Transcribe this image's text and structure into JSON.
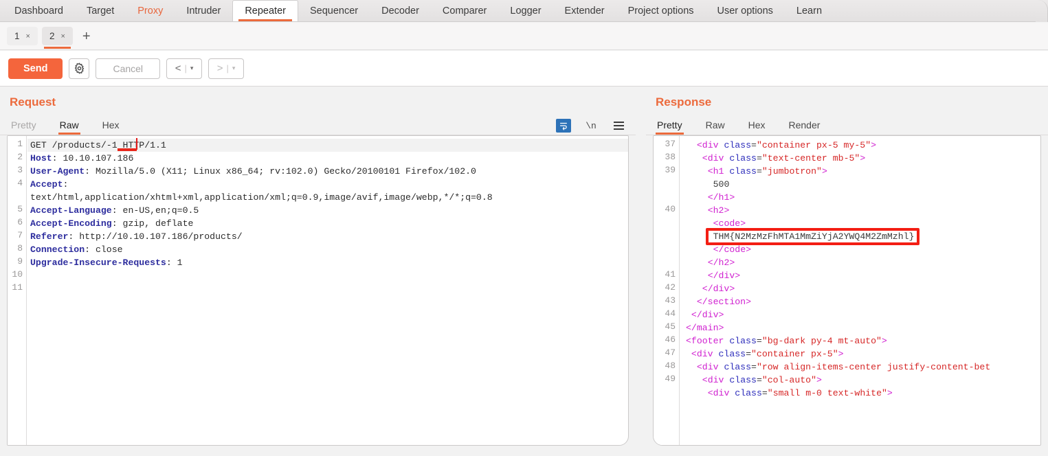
{
  "app": {
    "main_tabs": [
      {
        "label": "Dashboard",
        "state": "normal"
      },
      {
        "label": "Target",
        "state": "normal"
      },
      {
        "label": "Proxy",
        "state": "highlight"
      },
      {
        "label": "Intruder",
        "state": "normal"
      },
      {
        "label": "Repeater",
        "state": "active"
      },
      {
        "label": "Sequencer",
        "state": "normal"
      },
      {
        "label": "Decoder",
        "state": "normal"
      },
      {
        "label": "Comparer",
        "state": "normal"
      },
      {
        "label": "Logger",
        "state": "normal"
      },
      {
        "label": "Extender",
        "state": "normal"
      },
      {
        "label": "Project options",
        "state": "normal"
      },
      {
        "label": "User options",
        "state": "normal"
      },
      {
        "label": "Learn",
        "state": "normal"
      }
    ],
    "accent_color": "#ec6a3c",
    "highlight_color": "#e8663d"
  },
  "repeater_tabs": {
    "tabs": [
      {
        "number": "1",
        "close": "×",
        "active": false
      },
      {
        "number": "2",
        "close": "×",
        "active": true
      }
    ],
    "add_label": "+"
  },
  "toolbar": {
    "send_label": "Send",
    "gear_icon": "gear-icon",
    "cancel_label": "Cancel",
    "back_arrow": "<",
    "forward_arrow": ">",
    "separator": "|",
    "caret": "▾"
  },
  "request": {
    "title": "Request",
    "subtabs": [
      {
        "label": "Pretty",
        "active": false,
        "dim": true
      },
      {
        "label": "Raw",
        "active": true,
        "dim": false
      },
      {
        "label": "Hex",
        "active": false,
        "dim": false
      }
    ],
    "icons": [
      {
        "name": "word-wrap-icon",
        "selected": true
      },
      {
        "name": "newline-icon",
        "label": "\\n",
        "selected": false
      },
      {
        "name": "menu-icon",
        "selected": false
      }
    ],
    "lines": [
      {
        "n": "1",
        "highlight": true,
        "segments": [
          {
            "t": "GET /products/-1 HTTP/1.1",
            "c": "plain"
          }
        ]
      },
      {
        "n": "2",
        "segments": [
          {
            "t": "Host",
            "c": "hdr"
          },
          {
            "t": ": 10.10.107.186",
            "c": "val"
          }
        ]
      },
      {
        "n": "3",
        "segments": [
          {
            "t": "User-Agent",
            "c": "hdr"
          },
          {
            "t": ": Mozilla/5.0 (X11; Linux x86_64; rv:102.0) Gecko/20100101 Firefox/102.0",
            "c": "val"
          }
        ]
      },
      {
        "n": "4",
        "segments": [
          {
            "t": "Accept",
            "c": "hdr"
          },
          {
            "t": ":",
            "c": "val"
          }
        ]
      },
      {
        "n": "",
        "segments": [
          {
            "t": "text/html,application/xhtml+xml,application/xml;q=0.9,image/avif,image/webp,*/*;q=0.8",
            "c": "val"
          }
        ]
      },
      {
        "n": "5",
        "segments": [
          {
            "t": "Accept-Language",
            "c": "hdr"
          },
          {
            "t": ": en-US,en;q=0.5",
            "c": "val"
          }
        ]
      },
      {
        "n": "6",
        "segments": [
          {
            "t": "Accept-Encoding",
            "c": "hdr"
          },
          {
            "t": ": gzip, deflate",
            "c": "val"
          }
        ]
      },
      {
        "n": "7",
        "segments": [
          {
            "t": "Referer",
            "c": "hdr"
          },
          {
            "t": ": http://10.10.107.186/products/",
            "c": "val"
          }
        ]
      },
      {
        "n": "8",
        "segments": [
          {
            "t": "Connection",
            "c": "hdr"
          },
          {
            "t": ": close",
            "c": "val"
          }
        ]
      },
      {
        "n": "9",
        "segments": [
          {
            "t": "Upgrade-Insecure-Requests",
            "c": "hdr"
          },
          {
            "t": ": 1",
            "c": "val"
          }
        ]
      },
      {
        "n": "10",
        "segments": []
      },
      {
        "n": "11",
        "segments": []
      }
    ],
    "annotation": {
      "underline_text": "-1",
      "caret_visible": true
    }
  },
  "response": {
    "title": "Response",
    "subtabs": [
      {
        "label": "Pretty",
        "active": true,
        "dim": false
      },
      {
        "label": "Raw",
        "active": false,
        "dim": false
      },
      {
        "label": "Hex",
        "active": false,
        "dim": false
      },
      {
        "label": "Render",
        "active": false,
        "dim": false
      }
    ],
    "lines": [
      {
        "n": "37",
        "indent": 2,
        "segments": [
          {
            "t": "<",
            "c": "tag"
          },
          {
            "t": "div",
            "c": "tag"
          },
          {
            "t": " class",
            "c": "attr"
          },
          {
            "t": "=",
            "c": "txt"
          },
          {
            "t": "\"container px-5 my-5\"",
            "c": "str"
          },
          {
            "t": ">",
            "c": "tag"
          }
        ]
      },
      {
        "n": "38",
        "indent": 3,
        "segments": [
          {
            "t": "<",
            "c": "tag"
          },
          {
            "t": "div",
            "c": "tag"
          },
          {
            "t": " class",
            "c": "attr"
          },
          {
            "t": "=",
            "c": "txt"
          },
          {
            "t": "\"text-center mb-5\"",
            "c": "str"
          },
          {
            "t": ">",
            "c": "tag"
          }
        ]
      },
      {
        "n": "39",
        "indent": 4,
        "segments": [
          {
            "t": "<",
            "c": "tag"
          },
          {
            "t": "h1",
            "c": "tag"
          },
          {
            "t": " class",
            "c": "attr"
          },
          {
            "t": "=",
            "c": "txt"
          },
          {
            "t": "\"jumbotron\"",
            "c": "str"
          },
          {
            "t": ">",
            "c": "tag"
          }
        ]
      },
      {
        "n": "",
        "indent": 5,
        "segments": [
          {
            "t": "500",
            "c": "txt"
          }
        ]
      },
      {
        "n": "",
        "indent": 4,
        "segments": [
          {
            "t": "</h1>",
            "c": "tag"
          }
        ]
      },
      {
        "n": "40",
        "indent": 4,
        "segments": [
          {
            "t": "<h2>",
            "c": "tag"
          }
        ]
      },
      {
        "n": "",
        "indent": 5,
        "segments": [
          {
            "t": "<code>",
            "c": "tag"
          }
        ]
      },
      {
        "n": "",
        "indent": 5,
        "flag": true,
        "segments": [
          {
            "t": "THM{N2MzMzFhMTA1MmZiYjA2YWQ4M2ZmMzhl}",
            "c": "txt"
          }
        ]
      },
      {
        "n": "",
        "indent": 5,
        "segments": [
          {
            "t": "</code>",
            "c": "tag"
          }
        ]
      },
      {
        "n": "",
        "indent": 4,
        "segments": [
          {
            "t": "</h2>",
            "c": "tag"
          }
        ]
      },
      {
        "n": "41",
        "indent": 4,
        "segments": [
          {
            "t": "</div>",
            "c": "tag"
          }
        ]
      },
      {
        "n": "42",
        "indent": 3,
        "segments": [
          {
            "t": "</div>",
            "c": "tag"
          }
        ]
      },
      {
        "n": "43",
        "indent": 2,
        "segments": [
          {
            "t": "</section>",
            "c": "tag"
          }
        ]
      },
      {
        "n": "44",
        "indent": 1,
        "segments": [
          {
            "t": "</div>",
            "c": "tag"
          }
        ]
      },
      {
        "n": "45",
        "indent": 0,
        "segments": [
          {
            "t": "</main>",
            "c": "tag"
          }
        ]
      },
      {
        "n": "46",
        "indent": 0,
        "segments": [
          {
            "t": "<",
            "c": "tag"
          },
          {
            "t": "footer",
            "c": "tag"
          },
          {
            "t": " class",
            "c": "attr"
          },
          {
            "t": "=",
            "c": "txt"
          },
          {
            "t": "\"bg-dark py-4 mt-auto\"",
            "c": "str"
          },
          {
            "t": ">",
            "c": "tag"
          }
        ]
      },
      {
        "n": "47",
        "indent": 1,
        "segments": [
          {
            "t": "<",
            "c": "tag"
          },
          {
            "t": "div",
            "c": "tag"
          },
          {
            "t": " class",
            "c": "attr"
          },
          {
            "t": "=",
            "c": "txt"
          },
          {
            "t": "\"container px-5\"",
            "c": "str"
          },
          {
            "t": ">",
            "c": "tag"
          }
        ]
      },
      {
        "n": "48",
        "indent": 2,
        "segments": [
          {
            "t": "<",
            "c": "tag"
          },
          {
            "t": "div",
            "c": "tag"
          },
          {
            "t": " class",
            "c": "attr"
          },
          {
            "t": "=",
            "c": "txt"
          },
          {
            "t": "\"row align-items-center justify-content-bet",
            "c": "str"
          }
        ]
      },
      {
        "n": "49",
        "indent": 3,
        "segments": [
          {
            "t": "<",
            "c": "tag"
          },
          {
            "t": "div",
            "c": "tag"
          },
          {
            "t": " class",
            "c": "attr"
          },
          {
            "t": "=",
            "c": "txt"
          },
          {
            "t": "\"col-auto\"",
            "c": "str"
          },
          {
            "t": ">",
            "c": "tag"
          }
        ]
      },
      {
        "n": "",
        "indent": 4,
        "segments": [
          {
            "t": "<",
            "c": "tag"
          },
          {
            "t": "div",
            "c": "tag"
          },
          {
            "t": " class",
            "c": "attr"
          },
          {
            "t": "=",
            "c": "txt"
          },
          {
            "t": "\"small m-0 text-white\"",
            "c": "str"
          },
          {
            "t": ">",
            "c": "tag"
          }
        ]
      }
    ],
    "annotation": {
      "flag_box_color": "#f31e14",
      "flag_value": "THM{N2MzMzFhMTA1MmZiYjA2YWQ4M2ZmMzhl}"
    }
  }
}
